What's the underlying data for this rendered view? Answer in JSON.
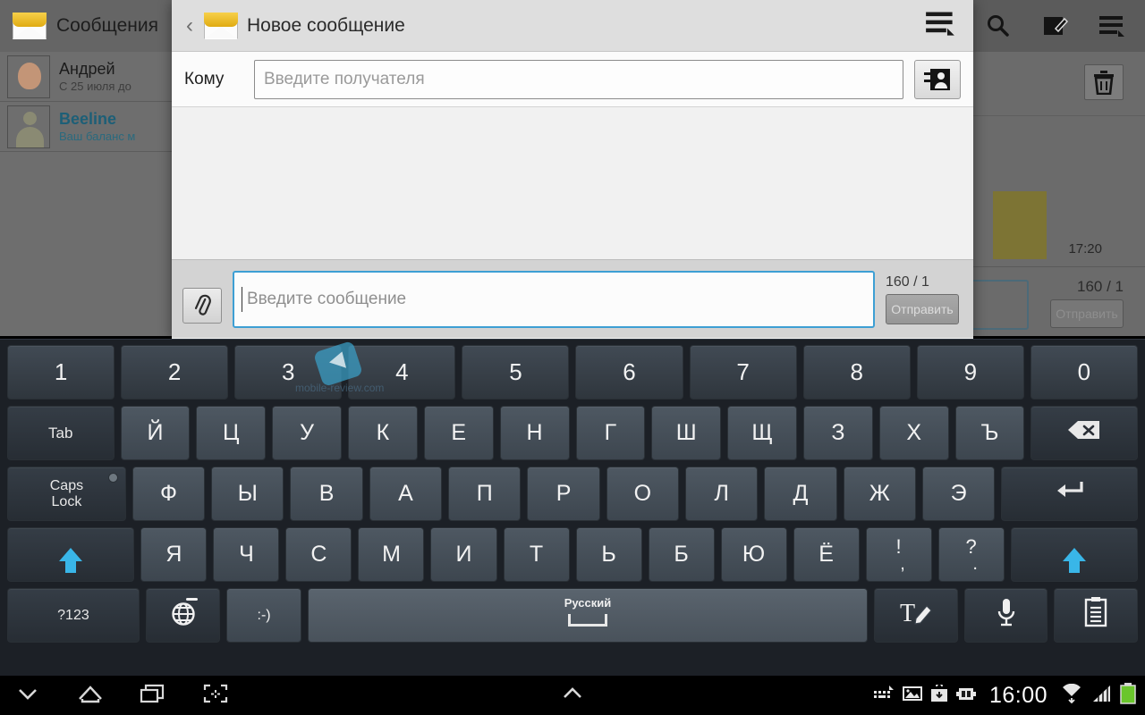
{
  "background": {
    "app_title": "Сообщения",
    "conversations": [
      {
        "name": "Андрей",
        "snippet": "С 25 июля до",
        "highlight": false
      },
      {
        "name": "Beeline",
        "snippet": "Ваш баланс м",
        "highlight": true
      }
    ],
    "bubble_time": "17:20",
    "char_count": "160 / 1",
    "send_label": "Отправить",
    "icons": {
      "menu": "menu-icon",
      "search": "search-icon",
      "compose": "compose-icon",
      "overflow": "overflow-menu-icon",
      "trash": "trash-icon"
    }
  },
  "dialog": {
    "back_glyph": "‹",
    "title": "Новое сообщение",
    "to_label": "Кому",
    "to_placeholder": "Введите получателя",
    "contact_icon": "contact-picker-icon",
    "menu_icon": "overflow-menu-icon",
    "attach_icon": "paperclip-icon",
    "message_placeholder": "Введите сообщение",
    "char_count": "160 / 1",
    "send_label": "Отправить"
  },
  "keyboard": {
    "rows": [
      {
        "name": "numbers",
        "keys": [
          {
            "label": "1",
            "name": "key-1",
            "cls": "num"
          },
          {
            "label": "2",
            "name": "key-2",
            "cls": "num"
          },
          {
            "label": "3",
            "name": "key-3",
            "cls": "num"
          },
          {
            "label": "4",
            "name": "key-4",
            "cls": "num"
          },
          {
            "label": "5",
            "name": "key-5",
            "cls": "num"
          },
          {
            "label": "6",
            "name": "key-6",
            "cls": "num"
          },
          {
            "label": "7",
            "name": "key-7",
            "cls": "num"
          },
          {
            "label": "8",
            "name": "key-8",
            "cls": "num"
          },
          {
            "label": "9",
            "name": "key-9",
            "cls": "num"
          },
          {
            "label": "0",
            "name": "key-0",
            "cls": "num"
          }
        ]
      },
      {
        "name": "top-letters",
        "keys": [
          {
            "label": "Tab",
            "name": "key-tab",
            "cls": "dark small k-tab"
          },
          {
            "label": "Й",
            "name": "key-cyrillic-i-short"
          },
          {
            "label": "Ц",
            "name": "key-cyrillic-ts"
          },
          {
            "label": "У",
            "name": "key-cyrillic-u"
          },
          {
            "label": "К",
            "name": "key-cyrillic-k"
          },
          {
            "label": "Е",
            "name": "key-cyrillic-ye"
          },
          {
            "label": "Н",
            "name": "key-cyrillic-n"
          },
          {
            "label": "Г",
            "name": "key-cyrillic-g"
          },
          {
            "label": "Ш",
            "name": "key-cyrillic-sh"
          },
          {
            "label": "Щ",
            "name": "key-cyrillic-shch"
          },
          {
            "label": "З",
            "name": "key-cyrillic-z"
          },
          {
            "label": "Х",
            "name": "key-cyrillic-h"
          },
          {
            "label": "Ъ",
            "name": "key-cyrillic-hard-sign"
          },
          {
            "label": "",
            "name": "key-backspace",
            "cls": "dark k-bsp",
            "icon": "backspace-icon"
          }
        ]
      },
      {
        "name": "home-letters",
        "keys": [
          {
            "label": "Caps Lock",
            "name": "key-caps-lock",
            "cls": "dark k-caps",
            "icon": "caps-lock-key"
          },
          {
            "label": "Ф",
            "name": "key-cyrillic-f"
          },
          {
            "label": "Ы",
            "name": "key-cyrillic-yery"
          },
          {
            "label": "В",
            "name": "key-cyrillic-v"
          },
          {
            "label": "А",
            "name": "key-cyrillic-a"
          },
          {
            "label": "П",
            "name": "key-cyrillic-p"
          },
          {
            "label": "Р",
            "name": "key-cyrillic-r"
          },
          {
            "label": "О",
            "name": "key-cyrillic-o"
          },
          {
            "label": "Л",
            "name": "key-cyrillic-l"
          },
          {
            "label": "Д",
            "name": "key-cyrillic-d"
          },
          {
            "label": "Ж",
            "name": "key-cyrillic-zh"
          },
          {
            "label": "Э",
            "name": "key-cyrillic-e"
          },
          {
            "label": "",
            "name": "key-enter",
            "cls": "dark k-enter",
            "icon": "enter-icon"
          }
        ]
      },
      {
        "name": "bottom-letters",
        "keys": [
          {
            "label": "",
            "name": "key-shift-left",
            "cls": "dark k-shift",
            "icon": "shift-arrow-icon"
          },
          {
            "label": "Я",
            "name": "key-cyrillic-ya"
          },
          {
            "label": "Ч",
            "name": "key-cyrillic-ch"
          },
          {
            "label": "С",
            "name": "key-cyrillic-s"
          },
          {
            "label": "М",
            "name": "key-cyrillic-m"
          },
          {
            "label": "И",
            "name": "key-cyrillic-i"
          },
          {
            "label": "Т",
            "name": "key-cyrillic-t"
          },
          {
            "label": "Ь",
            "name": "key-cyrillic-soft-sign"
          },
          {
            "label": "Б",
            "name": "key-cyrillic-b"
          },
          {
            "label": "Ю",
            "name": "key-cyrillic-yu"
          },
          {
            "label": "Ё",
            "name": "key-cyrillic-yo"
          },
          {
            "label": "!,",
            "top": "!",
            "bot": ",",
            "name": "key-exclamation-comma",
            "cls": "dual-key"
          },
          {
            "label": "?.",
            "top": "?",
            "bot": ".",
            "name": "key-question-period",
            "cls": "dual-key"
          },
          {
            "label": "",
            "name": "key-shift-right",
            "cls": "dark k-shift",
            "icon": "shift-arrow-icon"
          }
        ]
      },
      {
        "name": "function-row",
        "keys": [
          {
            "label": "?123",
            "name": "key-symbols",
            "cls": "dark fn k-sym"
          },
          {
            "label": "",
            "name": "key-language-globe",
            "cls": "dark k-globe",
            "icon": "globe-icon"
          },
          {
            "label": ":-)",
            "name": "key-emoticon",
            "cls": "fn k-emoji"
          },
          {
            "label": "Русский",
            "name": "key-space",
            "cls": "k-space",
            "icon": "spacebar"
          },
          {
            "label": "",
            "name": "key-handwriting",
            "cls": "dark k-tool",
            "icon": "handwriting-icon"
          },
          {
            "label": "",
            "name": "key-voice-input",
            "cls": "dark k-tool",
            "icon": "microphone-icon"
          },
          {
            "label": "",
            "name": "key-clipboard",
            "cls": "dark k-tool",
            "icon": "clipboard-icon"
          }
        ]
      }
    ],
    "space_language": "Русский"
  },
  "navbar": {
    "clock": "16:00",
    "left_icons": [
      "hide-keyboard-icon",
      "home-icon",
      "recent-apps-icon",
      "screenshot-icon"
    ],
    "center_icon": "expand-up-icon",
    "right_icons": [
      "keyboard-status-icon",
      "image-status-icon",
      "download-icon",
      "usb-icon",
      "wifi-icon",
      "signal-icon",
      "battery-icon"
    ]
  },
  "watermark": {
    "text": "mobile-review.com"
  }
}
